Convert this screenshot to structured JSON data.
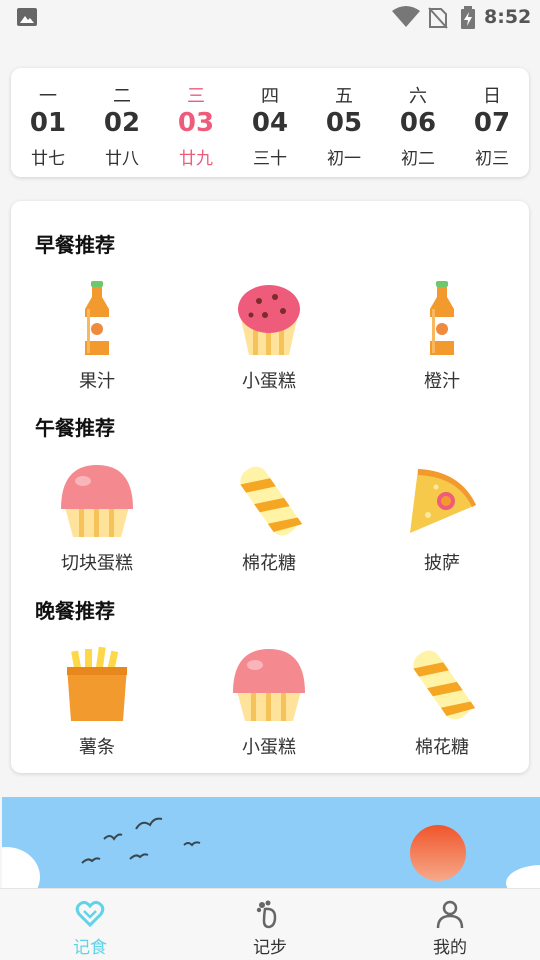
{
  "status_bar": {
    "time": "8:52"
  },
  "week": [
    {
      "weekday": "一",
      "date": "01",
      "lunar": "廿七",
      "active": false
    },
    {
      "weekday": "二",
      "date": "02",
      "lunar": "廿八",
      "active": false
    },
    {
      "weekday": "三",
      "date": "03",
      "lunar": "廿九",
      "active": true
    },
    {
      "weekday": "四",
      "date": "04",
      "lunar": "三十",
      "active": false
    },
    {
      "weekday": "五",
      "date": "05",
      "lunar": "初一",
      "active": false
    },
    {
      "weekday": "六",
      "date": "06",
      "lunar": "初二",
      "active": false
    },
    {
      "weekday": "日",
      "date": "07",
      "lunar": "初三",
      "active": false
    }
  ],
  "meals": {
    "breakfast": {
      "title": "早餐推荐",
      "items": [
        {
          "name": "果汁",
          "icon": "juice-bottle-icon"
        },
        {
          "name": "小蛋糕",
          "icon": "cupcake-icon"
        },
        {
          "name": "橙汁",
          "icon": "juice-bottle-icon"
        }
      ]
    },
    "lunch": {
      "title": "午餐推荐",
      "items": [
        {
          "name": "切块蛋糕",
          "icon": "muffin-icon"
        },
        {
          "name": "棉花糖",
          "icon": "candy-twist-icon"
        },
        {
          "name": "披萨",
          "icon": "pizza-slice-icon"
        }
      ]
    },
    "dinner": {
      "title": "晚餐推荐",
      "items": [
        {
          "name": "薯条",
          "icon": "fries-icon"
        },
        {
          "name": "小蛋糕",
          "icon": "muffin-icon"
        },
        {
          "name": "棉花糖",
          "icon": "candy-twist-icon"
        }
      ]
    }
  },
  "bottom_nav": [
    {
      "label": "记食",
      "icon": "heart-icon",
      "active": true
    },
    {
      "label": "记步",
      "icon": "footprint-icon",
      "active": false
    },
    {
      "label": "我的",
      "icon": "user-icon",
      "active": false
    }
  ],
  "colors": {
    "accent": "#ef5b7b",
    "nav_active": "#5fd4e8",
    "banner_sky": "#8dcdf7"
  }
}
